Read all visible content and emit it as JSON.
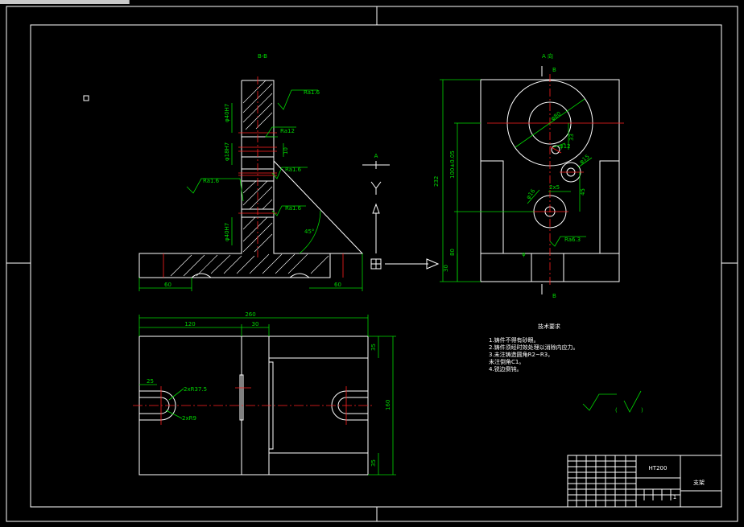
{
  "window": {
    "title": ""
  },
  "views": {
    "section_label": "B-B",
    "direction_label": "A 向",
    "arrow_label": "A",
    "cut_b_top": "B",
    "cut_b_bottom": "B"
  },
  "dims": {
    "overall_width": "260",
    "left_120": "120",
    "mid_30": "30",
    "slot_25": "25",
    "right_35_top": "35",
    "right_35_bottom": "35",
    "height_160": "160",
    "base_60_left": "60",
    "base_60_right": "60",
    "angle_45": "45°",
    "dim_10": "10",
    "diam_r1": "φ40H7",
    "diam_r2": "φ18H7",
    "diam_r3": "φ40H7",
    "radius_r375": "2xR37.5",
    "radius_r9": "2xR9",
    "a_232": "232",
    "a_k": "100±0.05",
    "a_80": "80",
    "a_30": "30",
    "a_45": "45",
    "a_phi": "φ80",
    "a_33": "33",
    "a_12": "φ12",
    "a_125": "φ15",
    "a_21": "2x5",
    "a_16": "φ16"
  },
  "surface_marks": {
    "m1": "Ra1.6",
    "m2": "Ra12",
    "m3": "Ra1.6",
    "m4": "Ra1.6",
    "m5": "Ra1.6",
    "m6": "Ra6.3"
  },
  "notes": {
    "title": "技术要求",
    "items": [
      "1.铸件不得有砂眼。",
      "2.铸件须经时效处理以消除内应力。",
      "3.未注铸造圆角R2~R3，",
      "未注倒角C1。",
      "4.锐边倒钝。"
    ]
  },
  "roughness_symbol": {
    "paren_open": "(",
    "paren_close": ")"
  },
  "title_block": {
    "material": "HT200",
    "name": "支架",
    "scale_cell": "1"
  }
}
